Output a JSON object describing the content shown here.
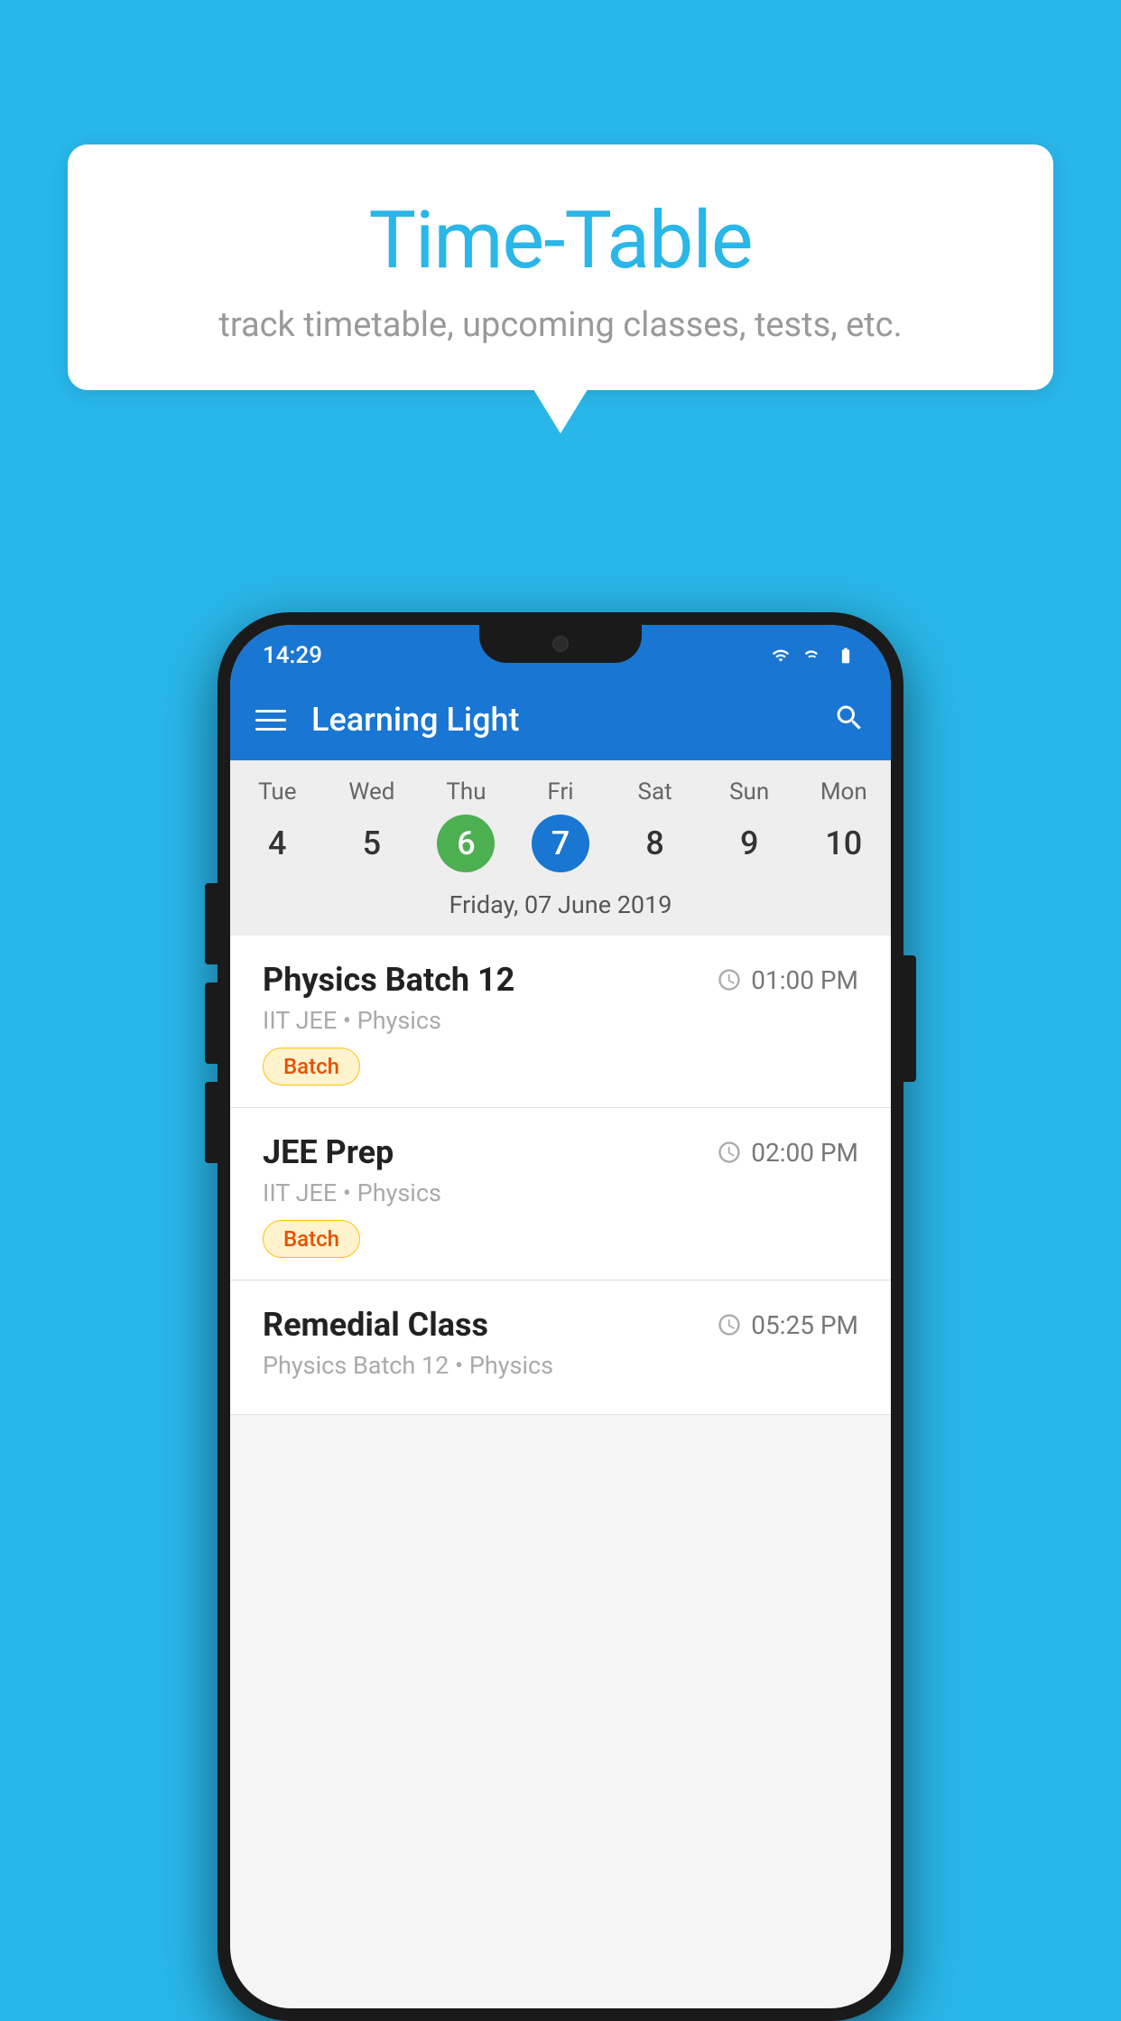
{
  "background_color": "#29b6e8",
  "bubble": {
    "title": "Time-Table",
    "subtitle": "track timetable, upcoming classes, tests, etc."
  },
  "phone": {
    "status_bar": {
      "time": "14:29"
    },
    "app_bar": {
      "title": "Learning Light"
    },
    "calendar": {
      "days": [
        {
          "label": "Tue",
          "num": "4",
          "state": "normal"
        },
        {
          "label": "Wed",
          "num": "5",
          "state": "normal"
        },
        {
          "label": "Thu",
          "num": "6",
          "state": "today"
        },
        {
          "label": "Fri",
          "num": "7",
          "state": "selected"
        },
        {
          "label": "Sat",
          "num": "8",
          "state": "normal"
        },
        {
          "label": "Sun",
          "num": "9",
          "state": "normal"
        },
        {
          "label": "Mon",
          "num": "10",
          "state": "normal"
        }
      ],
      "selected_date_label": "Friday, 07 June 2019"
    },
    "schedule": [
      {
        "title": "Physics Batch 12",
        "time": "01:00 PM",
        "sub": "IIT JEE • Physics",
        "badge": "Batch"
      },
      {
        "title": "JEE Prep",
        "time": "02:00 PM",
        "sub": "IIT JEE • Physics",
        "badge": "Batch"
      },
      {
        "title": "Remedial Class",
        "time": "05:25 PM",
        "sub": "Physics Batch 12 • Physics",
        "badge": ""
      }
    ]
  }
}
